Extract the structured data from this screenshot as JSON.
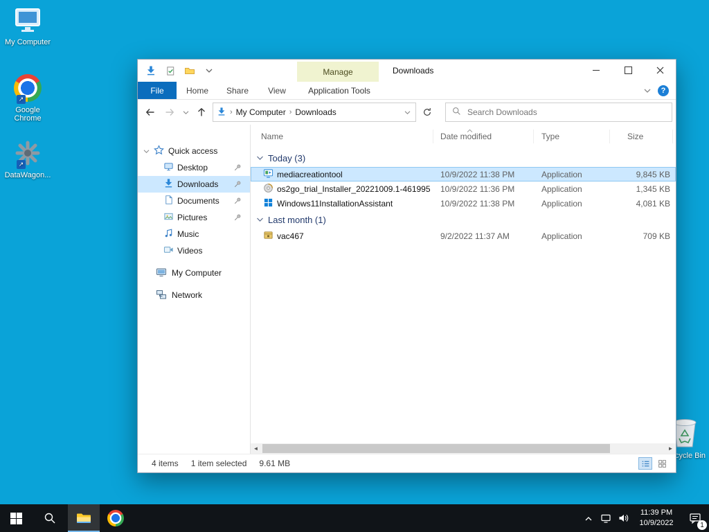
{
  "desktop": {
    "icons": {
      "computer": "My Computer",
      "chrome": "Google Chrome",
      "datawagon": "DataWagon...",
      "recycle": "Recycle Bin"
    }
  },
  "explorer": {
    "title": "Downloads",
    "contextual_group": "Manage",
    "tabs": {
      "file": "File",
      "home": "Home",
      "share": "Share",
      "view": "View",
      "app_tools": "Application Tools"
    },
    "address": {
      "crumb_root": "My Computer",
      "crumb_current": "Downloads",
      "separator": "›",
      "search_placeholder": "Search Downloads"
    },
    "columns": {
      "name": "Name",
      "date": "Date modified",
      "type": "Type",
      "size": "Size"
    },
    "groups": {
      "today": "Today (3)",
      "last_month": "Last month (1)"
    },
    "files": [
      {
        "name": "mediacreationtool",
        "date": "10/9/2022 11:38 PM",
        "type": "Application",
        "size": "9,845 KB"
      },
      {
        "name": "os2go_trial_Installer_20221009.1-461995",
        "date": "10/9/2022 11:36 PM",
        "type": "Application",
        "size": "1,345 KB"
      },
      {
        "name": "Windows11InstallationAssistant",
        "date": "10/9/2022 11:38 PM",
        "type": "Application",
        "size": "4,081 KB"
      },
      {
        "name": "vac467",
        "date": "9/2/2022 11:37 AM",
        "type": "Application",
        "size": "709 KB"
      }
    ],
    "sidebar": {
      "quick_access": "Quick access",
      "items": [
        {
          "label": "Desktop"
        },
        {
          "label": "Downloads"
        },
        {
          "label": "Documents"
        },
        {
          "label": "Pictures"
        },
        {
          "label": "Music"
        },
        {
          "label": "Videos"
        }
      ],
      "computer": "My Computer",
      "network": "Network"
    },
    "status": {
      "count": "4 items",
      "selected": "1 item selected",
      "size": "9.61 MB"
    }
  },
  "taskbar": {
    "clock_time": "11:39 PM",
    "clock_date": "10/9/2022",
    "badge": "1"
  },
  "icons": {
    "help": "?",
    "shortcut_arrow": "↗",
    "scroll_left": "◄",
    "scroll_right": "►"
  },
  "colors": {
    "desktop_bg": "#0aa3d8",
    "accent_blue": "#0b6dbd",
    "selection": "#cce8ff",
    "manage_tab_bg": "#f0f3d0",
    "taskbar_bg": "#101418"
  }
}
